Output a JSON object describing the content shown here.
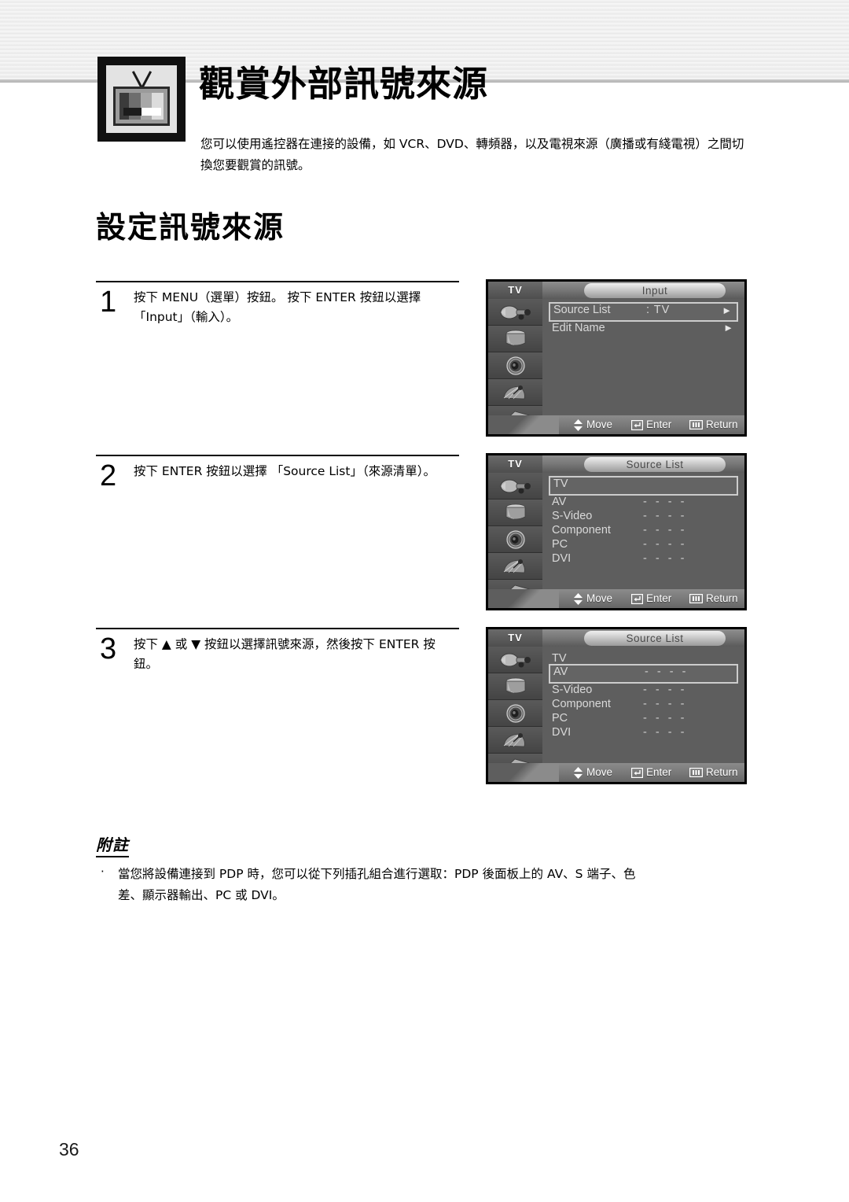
{
  "page": {
    "number": "36"
  },
  "header": {
    "icon_name": "tv-chapter-icon",
    "chapter_title": "觀賞外部訊號來源",
    "chapter_description": "您可以使用遙控器在連接的設備，如 VCR、DVD、轉頻器，以及電視來源（廣播或有綫電視）之間切換您要觀賞的訊號。"
  },
  "section": {
    "heading": "設定訊號來源"
  },
  "steps": [
    {
      "number": "1",
      "text": "按下 MENU（選單）按鈕。 按下 ENTER 按鈕以選擇「Input」（輸入）。"
    },
    {
      "number": "2",
      "text": "按下 ENTER 按鈕以選擇 「Source List」（來源清單）。"
    },
    {
      "number": "3",
      "text": "按下 ▲ 或 ▼ 按鈕以選擇訊號來源，然後按下 ENTER 按鈕。"
    }
  ],
  "osd_common": {
    "tv_label": "TV",
    "hints": {
      "move": "Move",
      "enter": "Enter",
      "return": "Return"
    },
    "sidebar_icons": [
      "antenna-input-icon",
      "picture-tube-icon",
      "speaker-icon",
      "setup-dish-icon",
      "cables-icon"
    ],
    "dashes": "- - - -",
    "arrow_glyph": "►"
  },
  "osd_panels": [
    {
      "name": "input-menu",
      "title": "Input",
      "rows": [
        {
          "label": "Source List",
          "value": ": TV",
          "arrow": "►",
          "selected": true
        },
        {
          "label": "Edit Name",
          "value": "",
          "arrow": "►",
          "selected": false
        }
      ]
    },
    {
      "name": "source-list-tv-selected",
      "title": "Source List",
      "rows": [
        {
          "label": "TV",
          "dashes": "",
          "selected": true
        },
        {
          "label": "AV",
          "dashes": "- - - -",
          "selected": false
        },
        {
          "label": "S-Video",
          "dashes": "- - - -",
          "selected": false
        },
        {
          "label": "Component",
          "dashes": "- - - -",
          "selected": false
        },
        {
          "label": "PC",
          "dashes": "- - - -",
          "selected": false
        },
        {
          "label": "DVI",
          "dashes": "- - - -",
          "selected": false
        }
      ]
    },
    {
      "name": "source-list-av-selected",
      "title": "Source List",
      "rows": [
        {
          "label": "TV",
          "dashes": "",
          "selected": false
        },
        {
          "label": "AV",
          "dashes": "- - - -",
          "selected": true
        },
        {
          "label": "S-Video",
          "dashes": "- - - -",
          "selected": false
        },
        {
          "label": "Component",
          "dashes": "- - - -",
          "selected": false
        },
        {
          "label": "PC",
          "dashes": "- - - -",
          "selected": false
        },
        {
          "label": "DVI",
          "dashes": "- - - -",
          "selected": false
        }
      ]
    }
  ],
  "note": {
    "title": "附註",
    "bullet": "·",
    "items": [
      "當您將設備連接到 PDP 時，您可以從下列插孔組合進行選取：PDP 後面板上的 AV、S 端子、色差、顯示器輸出、PC 或 DVI。"
    ]
  },
  "colors": {
    "osd_background": "#5e5e5e",
    "osd_sidebar": "#4a4a4a",
    "osd_border": "#000000",
    "text_light": "#d9d9d9",
    "page_background": "#ffffff"
  }
}
